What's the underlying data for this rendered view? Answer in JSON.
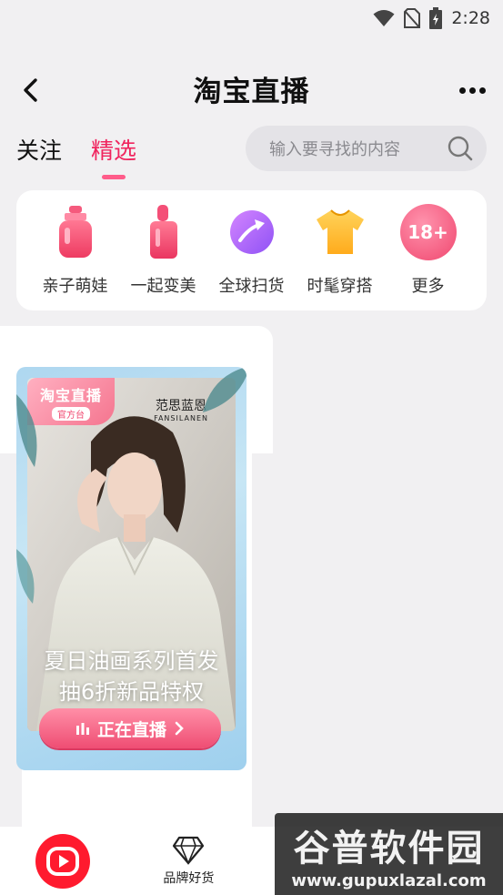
{
  "status_bar": {
    "time": "2:28",
    "icons": [
      "wifi-icon",
      "no-sim-icon",
      "battery-icon"
    ]
  },
  "header": {
    "title": "淘宝直播",
    "back_icon": "back-arrow-icon",
    "more_icon": "more-dots-icon"
  },
  "tabs": [
    {
      "label": "关注",
      "active": false
    },
    {
      "label": "精选",
      "active": true
    }
  ],
  "search": {
    "placeholder": "输入要寻找的内容",
    "icon": "search-icon"
  },
  "categories": [
    {
      "label": "亲子萌娃",
      "icon": "baby-bottle-icon"
    },
    {
      "label": "一起变美",
      "icon": "lipstick-icon"
    },
    {
      "label": "全球扫货",
      "icon": "globe-arrow-icon"
    },
    {
      "label": "时髦穿搭",
      "icon": "tshirt-icon"
    },
    {
      "label": "更多",
      "icon": "badge-18-icon",
      "badge_text": "18+"
    }
  ],
  "live_card": {
    "badge_title": "淘宝直播",
    "badge_sub": "官方台",
    "brand_cn": "范思蓝恩",
    "brand_en": "FANSILANEN",
    "title_line1": "夏日油画系列首发",
    "title_line2": "抽6折新品特权",
    "live_button": "正在直播"
  },
  "bottom_nav": [
    {
      "label": "",
      "icon": "live-play-icon"
    },
    {
      "label": "品牌好货",
      "icon": "diamond-icon"
    }
  ],
  "watermark": {
    "title": "谷普软件园",
    "url": "www.gupuxlazal.com"
  },
  "colors": {
    "accent": "#f0245e",
    "pink_light": "#ff8fa7",
    "page_bg": "#f1f0f2"
  }
}
